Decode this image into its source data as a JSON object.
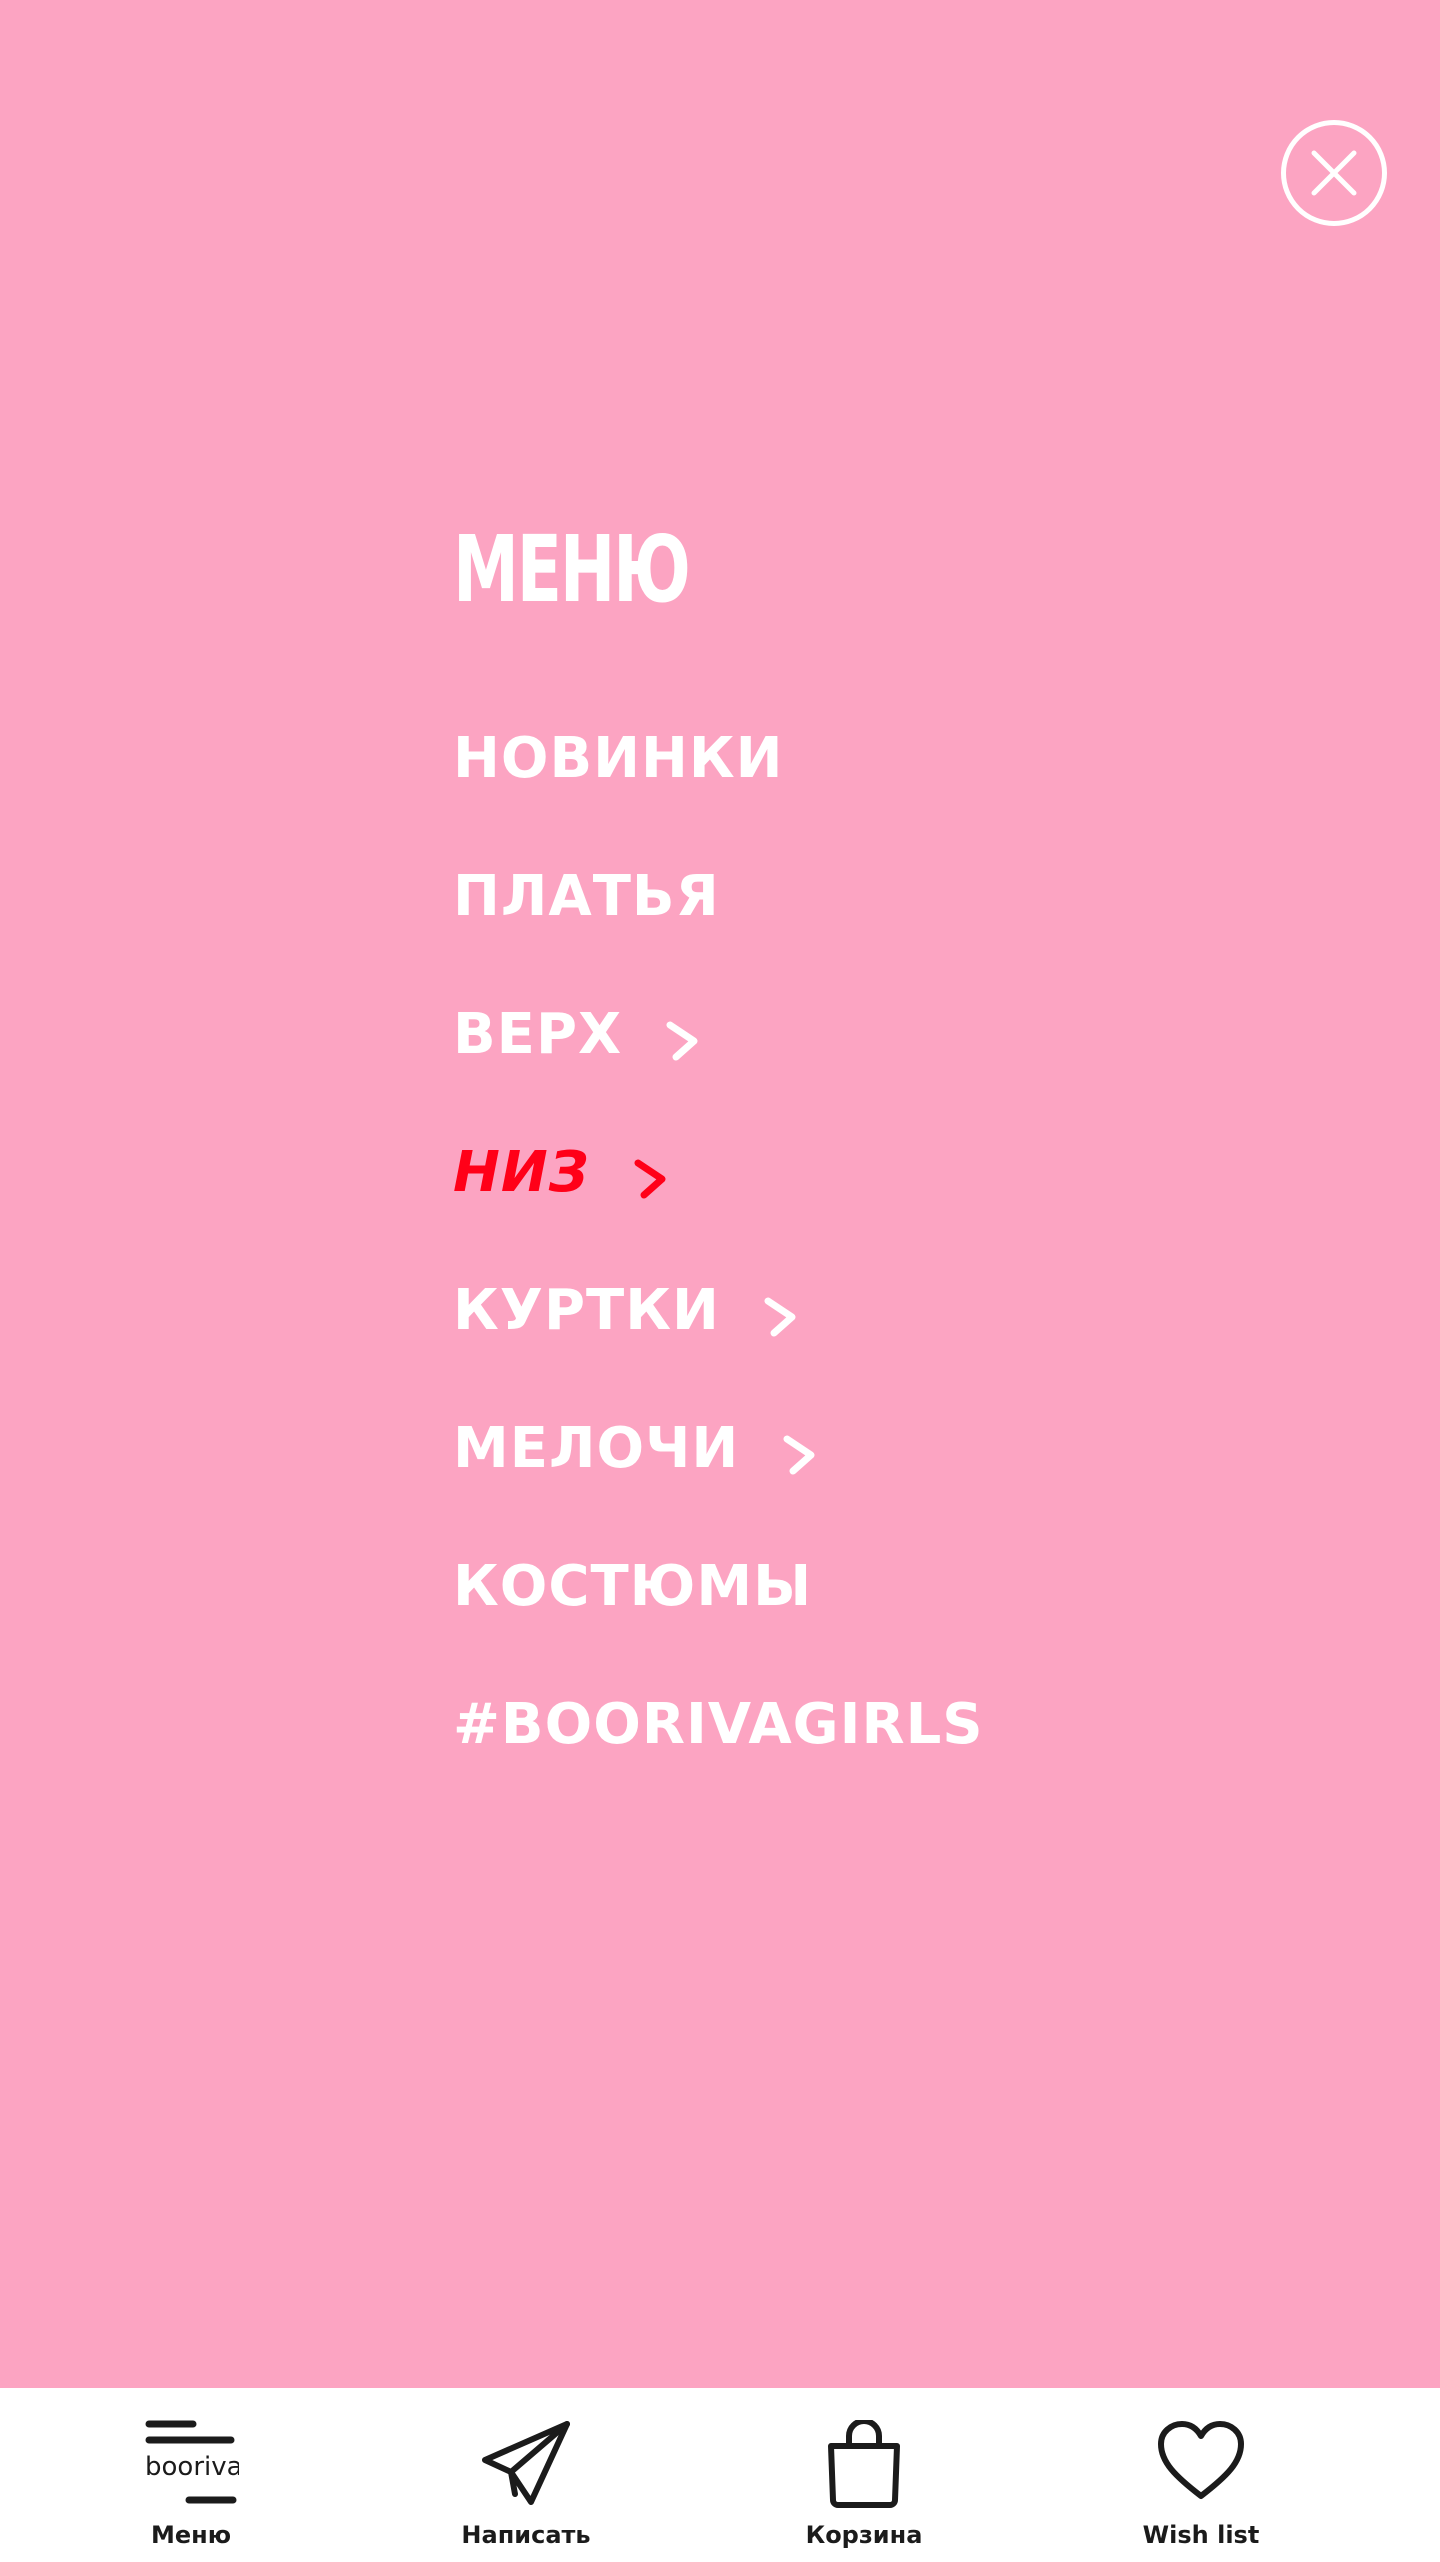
{
  "colors": {
    "background": "#fca4c2",
    "text": "#ffffff",
    "active": "#ff0018",
    "bar": "#ffffff",
    "icon": "#1b1b1b"
  },
  "header": {
    "close_icon": "close-icon"
  },
  "menu": {
    "title": "МЕНЮ",
    "items": [
      {
        "label": "НОВИНКИ",
        "has_submenu": false,
        "active": false
      },
      {
        "label": "ПЛАТЬЯ",
        "has_submenu": false,
        "active": false
      },
      {
        "label": "ВЕРХ",
        "has_submenu": true,
        "active": false
      },
      {
        "label": "НИЗ",
        "has_submenu": true,
        "active": true
      },
      {
        "label": "КУРТКИ",
        "has_submenu": true,
        "active": false
      },
      {
        "label": "МЕЛОЧИ",
        "has_submenu": true,
        "active": false
      },
      {
        "label": "КОСТЮМЫ",
        "has_submenu": false,
        "active": false
      },
      {
        "label": "#BOORIVAGIRLS",
        "has_submenu": false,
        "active": false
      }
    ]
  },
  "bottom_nav": {
    "items": [
      {
        "label": "Меню",
        "icon": "menu-logo-icon",
        "brand": "booriva"
      },
      {
        "label": "Написать",
        "icon": "paper-plane-icon"
      },
      {
        "label": "Корзина",
        "icon": "shopping-bag-icon"
      },
      {
        "label": "Wish list",
        "icon": "heart-icon"
      }
    ]
  }
}
